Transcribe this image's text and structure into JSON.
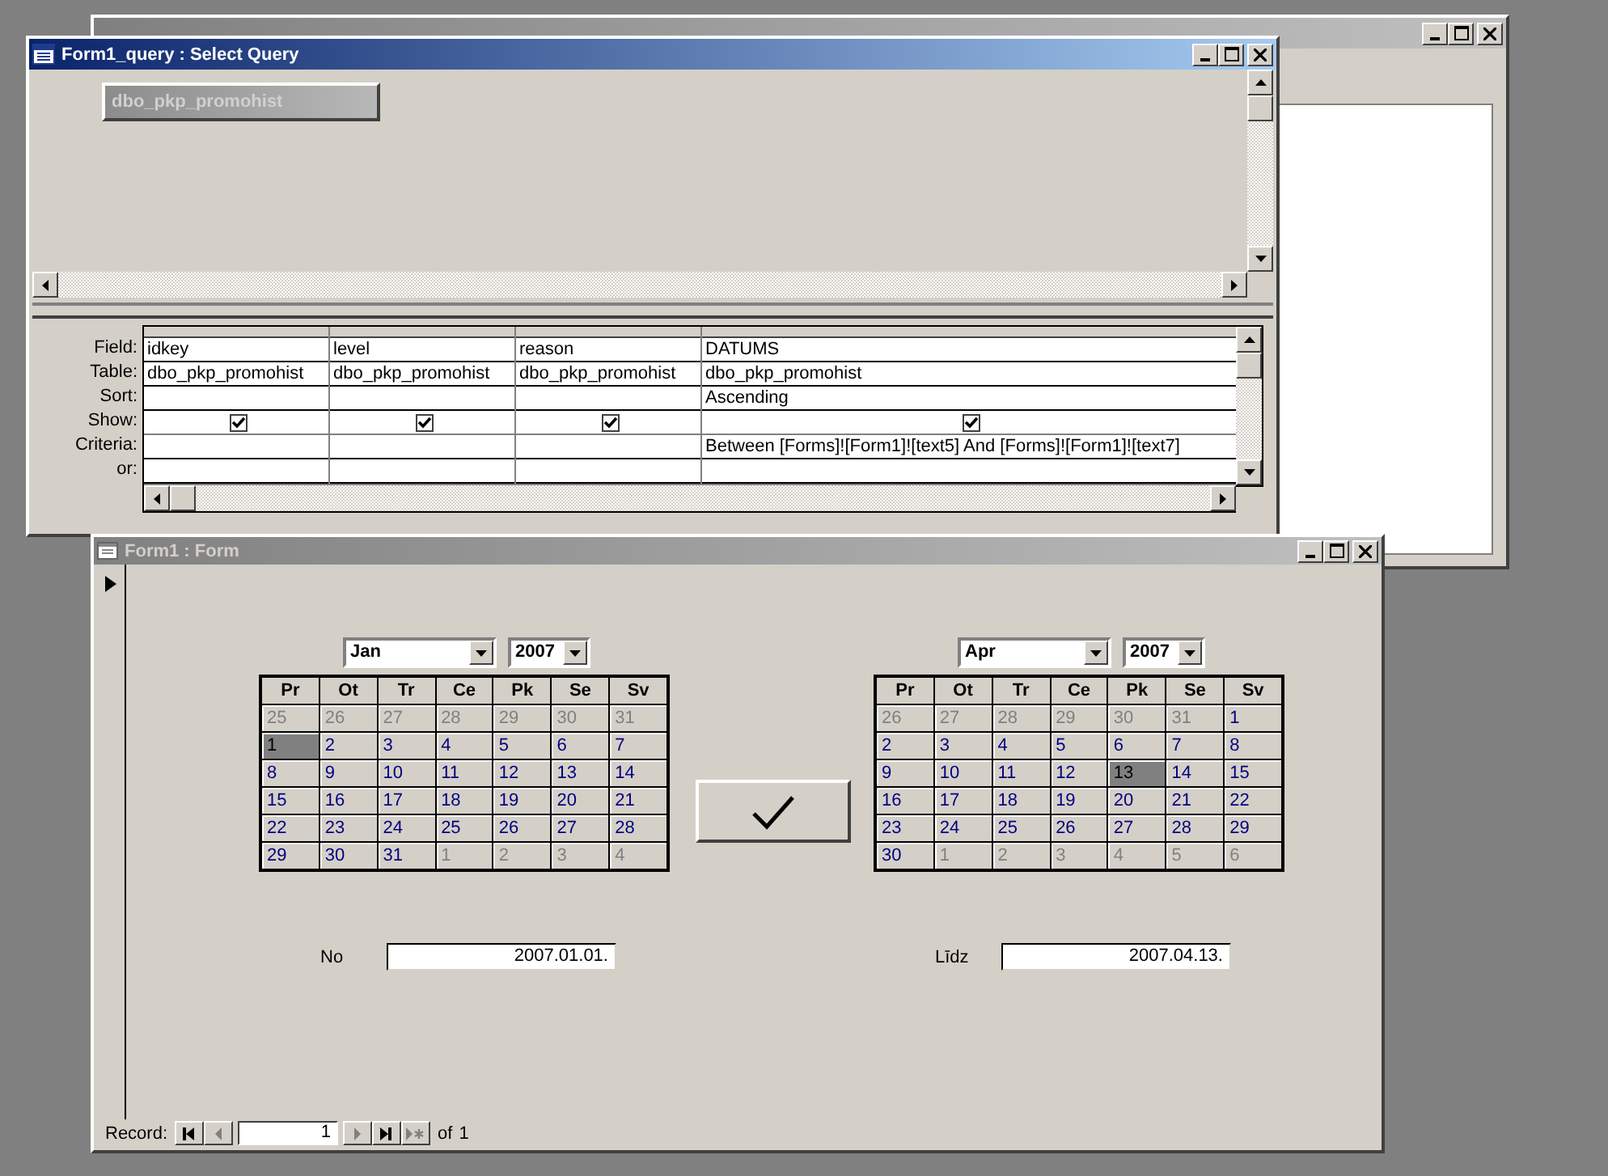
{
  "database_window": {
    "active": false
  },
  "query_window": {
    "title": "Form1_query : Select Query",
    "active": true,
    "table_list": [
      "dbo_pkp_promohist"
    ],
    "row_labels": [
      "Field:",
      "Table:",
      "Sort:",
      "Show:",
      "Criteria:",
      "or:"
    ],
    "columns": [
      {
        "field": "idkey",
        "table": "dbo_pkp_promohist",
        "show": true
      },
      {
        "field": "level",
        "table": "dbo_pkp_promohist",
        "show": true
      },
      {
        "field": "reason",
        "table": "dbo_pkp_promohist",
        "show": true
      },
      {
        "field": "DATUMS",
        "table": "dbo_pkp_promohist",
        "sort": "Ascending",
        "show": true,
        "criteria": "Between [Forms]![Form1]![text5] And [Forms]![Form1]![text7]"
      }
    ]
  },
  "form_window": {
    "title": "Form1 : Form",
    "active": false,
    "calendars": [
      {
        "month": "Jan",
        "year": "2007",
        "weekdays": [
          "Pr",
          "Ot",
          "Tr",
          "Ce",
          "Pk",
          "Se",
          "Sv"
        ],
        "weeks": [
          [
            {
              "day": "25",
              "muted": true,
              "selected": false
            },
            {
              "day": "26",
              "muted": true,
              "selected": false
            },
            {
              "day": "27",
              "muted": true,
              "selected": false
            },
            {
              "day": "28",
              "muted": true,
              "selected": false
            },
            {
              "day": "29",
              "muted": true,
              "selected": false
            },
            {
              "day": "30",
              "muted": true,
              "selected": false
            },
            {
              "day": "31",
              "muted": true,
              "selected": false
            }
          ],
          [
            {
              "day": "1",
              "muted": false,
              "selected": true
            },
            {
              "day": "2",
              "muted": false,
              "selected": false
            },
            {
              "day": "3",
              "muted": false,
              "selected": false
            },
            {
              "day": "4",
              "muted": false,
              "selected": false
            },
            {
              "day": "5",
              "muted": false,
              "selected": false
            },
            {
              "day": "6",
              "muted": false,
              "selected": false
            },
            {
              "day": "7",
              "muted": false,
              "selected": false
            }
          ],
          [
            {
              "day": "8",
              "muted": false,
              "selected": false
            },
            {
              "day": "9",
              "muted": false,
              "selected": false
            },
            {
              "day": "10",
              "muted": false,
              "selected": false
            },
            {
              "day": "11",
              "muted": false,
              "selected": false
            },
            {
              "day": "12",
              "muted": false,
              "selected": false
            },
            {
              "day": "13",
              "muted": false,
              "selected": false
            },
            {
              "day": "14",
              "muted": false,
              "selected": false
            }
          ],
          [
            {
              "day": "15",
              "muted": false,
              "selected": false
            },
            {
              "day": "16",
              "muted": false,
              "selected": false
            },
            {
              "day": "17",
              "muted": false,
              "selected": false
            },
            {
              "day": "18",
              "muted": false,
              "selected": false
            },
            {
              "day": "19",
              "muted": false,
              "selected": false
            },
            {
              "day": "20",
              "muted": false,
              "selected": false
            },
            {
              "day": "21",
              "muted": false,
              "selected": false
            }
          ],
          [
            {
              "day": "22",
              "muted": false,
              "selected": false
            },
            {
              "day": "23",
              "muted": false,
              "selected": false
            },
            {
              "day": "24",
              "muted": false,
              "selected": false
            },
            {
              "day": "25",
              "muted": false,
              "selected": false
            },
            {
              "day": "26",
              "muted": false,
              "selected": false
            },
            {
              "day": "27",
              "muted": false,
              "selected": false
            },
            {
              "day": "28",
              "muted": false,
              "selected": false
            }
          ],
          [
            {
              "day": "29",
              "muted": false,
              "selected": false
            },
            {
              "day": "30",
              "muted": false,
              "selected": false
            },
            {
              "day": "31",
              "muted": false,
              "selected": false
            },
            {
              "day": "1",
              "muted": true,
              "selected": false
            },
            {
              "day": "2",
              "muted": true,
              "selected": false
            },
            {
              "day": "3",
              "muted": true,
              "selected": false
            },
            {
              "day": "4",
              "muted": true,
              "selected": false
            }
          ]
        ]
      },
      {
        "month": "Apr",
        "year": "2007",
        "weekdays": [
          "Pr",
          "Ot",
          "Tr",
          "Ce",
          "Pk",
          "Se",
          "Sv"
        ],
        "weeks": [
          [
            {
              "day": "26",
              "muted": true,
              "selected": false
            },
            {
              "day": "27",
              "muted": true,
              "selected": false
            },
            {
              "day": "28",
              "muted": true,
              "selected": false
            },
            {
              "day": "29",
              "muted": true,
              "selected": false
            },
            {
              "day": "30",
              "muted": true,
              "selected": false
            },
            {
              "day": "31",
              "muted": true,
              "selected": false
            },
            {
              "day": "1",
              "muted": false,
              "selected": false
            }
          ],
          [
            {
              "day": "2",
              "muted": false,
              "selected": false
            },
            {
              "day": "3",
              "muted": false,
              "selected": false
            },
            {
              "day": "4",
              "muted": false,
              "selected": false
            },
            {
              "day": "5",
              "muted": false,
              "selected": false
            },
            {
              "day": "6",
              "muted": false,
              "selected": false
            },
            {
              "day": "7",
              "muted": false,
              "selected": false
            },
            {
              "day": "8",
              "muted": false,
              "selected": false
            }
          ],
          [
            {
              "day": "9",
              "muted": false,
              "selected": false
            },
            {
              "day": "10",
              "muted": false,
              "selected": false
            },
            {
              "day": "11",
              "muted": false,
              "selected": false
            },
            {
              "day": "12",
              "muted": false,
              "selected": false
            },
            {
              "day": "13",
              "muted": false,
              "selected": true
            },
            {
              "day": "14",
              "muted": false,
              "selected": false
            },
            {
              "day": "15",
              "muted": false,
              "selected": false
            }
          ],
          [
            {
              "day": "16",
              "muted": false,
              "selected": false
            },
            {
              "day": "17",
              "muted": false,
              "selected": false
            },
            {
              "day": "18",
              "muted": false,
              "selected": false
            },
            {
              "day": "19",
              "muted": false,
              "selected": false
            },
            {
              "day": "20",
              "muted": false,
              "selected": false
            },
            {
              "day": "21",
              "muted": false,
              "selected": false
            },
            {
              "day": "22",
              "muted": false,
              "selected": false
            }
          ],
          [
            {
              "day": "23",
              "muted": false,
              "selected": false
            },
            {
              "day": "24",
              "muted": false,
              "selected": false
            },
            {
              "day": "25",
              "muted": false,
              "selected": false
            },
            {
              "day": "26",
              "muted": false,
              "selected": false
            },
            {
              "day": "27",
              "muted": false,
              "selected": false
            },
            {
              "day": "28",
              "muted": false,
              "selected": false
            },
            {
              "day": "29",
              "muted": false,
              "selected": false
            }
          ],
          [
            {
              "day": "30",
              "muted": false,
              "selected": false
            },
            {
              "day": "1",
              "muted": true,
              "selected": false
            },
            {
              "day": "2",
              "muted": true,
              "selected": false
            },
            {
              "day": "3",
              "muted": true,
              "selected": false
            },
            {
              "day": "4",
              "muted": true,
              "selected": false
            },
            {
              "day": "5",
              "muted": true,
              "selected": false
            },
            {
              "day": "6",
              "muted": true,
              "selected": false
            }
          ]
        ]
      }
    ],
    "date_fields": [
      {
        "label": "No",
        "value": "2007.01.01."
      },
      {
        "label": "Līdz",
        "value": "2007.04.13."
      }
    ],
    "record_nav": {
      "label": "Record:",
      "current": "1",
      "of": "of",
      "total": "1",
      "buttons": [
        {
          "kind": "first",
          "disabled": false
        },
        {
          "kind": "prev",
          "disabled": true
        },
        {
          "kind": "next",
          "disabled": true
        },
        {
          "kind": "last",
          "disabled": false
        },
        {
          "kind": "new",
          "disabled": true
        }
      ]
    }
  }
}
